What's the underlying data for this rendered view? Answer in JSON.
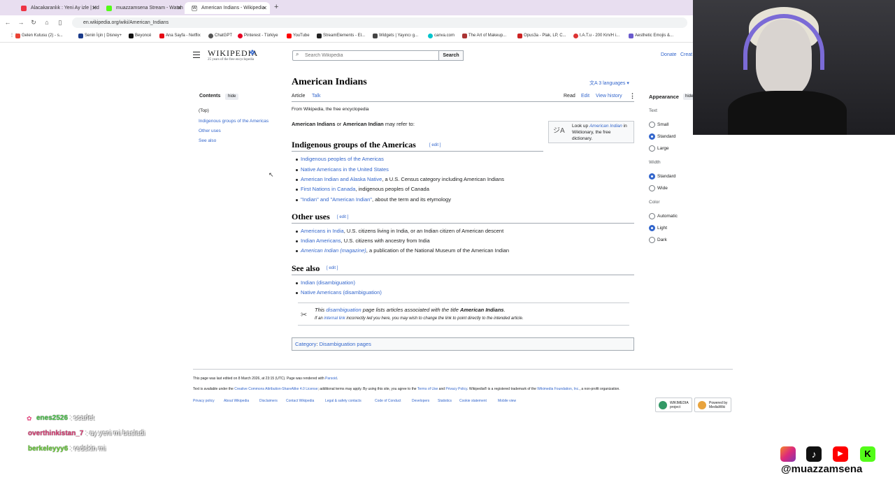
{
  "browser": {
    "tabs": [
      {
        "title": "Alacakaranlık : Yeni Ay izle | Hd"
      },
      {
        "title": "muazzamsena Stream - Watch"
      },
      {
        "title": "American Indians - Wikipedia"
      }
    ],
    "new_tab": "+",
    "url": "en.wikipedia.org/wiki/American_Indians",
    "bookmarks": [
      "Gelen Kutusu (2) - s...",
      "Senin İçin | Disney+",
      "Beyoncé",
      "Ana Sayfa - Netflix",
      "ChatGPT",
      "Pinterest - Türkiye",
      "YouTube",
      "StreamElements - El...",
      "Widgets | Yayıncı g...",
      "canva.com",
      "The Art of Makeup...",
      "Opus3a - Plak, LP, C...",
      "t.A.T.u - 200 Km/H i...",
      "Aesthetic Emojis &..."
    ]
  },
  "wiki": {
    "logo_title": "WIKIPEDIA",
    "logo_tagline": "25 years of the free encyclopedia",
    "search_placeholder": "Search Wikipedia",
    "search_button": "Search",
    "donate": "Donate",
    "create": "Creat",
    "toc": {
      "title": "Contents",
      "hide": "hide",
      "items": [
        "(Top)",
        "Indigenous groups of the Americas",
        "Other uses",
        "See also"
      ]
    },
    "page_title": "American Indians",
    "languages": "3 languages",
    "tabs": {
      "article": "Article",
      "talk": "Talk",
      "read": "Read",
      "edit": "Edit",
      "history": "View history"
    },
    "from_wp": "From Wikipedia, the free encyclopedia",
    "lead_b1": "American Indians",
    "lead_or": " or ",
    "lead_b2": "American Indian",
    "lead_rest": " may refer to:",
    "wiktionary": {
      "pre": "Look up ",
      "term": "American Indian",
      "post": " in Wiktionary, the free dictionary."
    },
    "edit_label": "edit",
    "sections": {
      "indigenous": {
        "heading": "Indigenous groups of the Americas",
        "items": [
          {
            "link": "Indigenous peoples of the Americas",
            "text": ""
          },
          {
            "link": "Native Americans in the United States",
            "text": ""
          },
          {
            "link": "American Indian and Alaska Native",
            "text": ", a U.S. Census category including American Indians"
          },
          {
            "link": "First Nations in Canada",
            "text": ", indigenous peoples of Canada"
          },
          {
            "link": "\"Indian\" and \"American Indian\"",
            "text": ", about the term and its etymology"
          }
        ]
      },
      "other": {
        "heading": "Other uses",
        "items": [
          {
            "link": "Americans in India",
            "text": ", U.S. citizens living in India, or an Indian citizen of American descent"
          },
          {
            "link": "Indian Americans",
            "text": ", U.S. citizens with ancestry from India"
          },
          {
            "link": "American Indian (magazine)",
            "text": ", a publication of the National Museum of the American Indian"
          }
        ]
      },
      "see_also": {
        "heading": "See also",
        "items": [
          {
            "link": "Indian (disambiguation)",
            "text": ""
          },
          {
            "link": "Native Americans (disambiguation)",
            "text": ""
          }
        ]
      }
    },
    "dab": {
      "pre": "This ",
      "link": "disambiguation",
      "mid": " page lists articles associated with the title ",
      "title": "American Indians",
      "post": ".",
      "line2_pre": "If an ",
      "line2_link": "internal link",
      "line2_post": " incorrectly led you here, you may wish to change the link to point directly to the intended article."
    },
    "category": {
      "label": "Category",
      "sep": ":",
      "value": "Disambiguation pages"
    },
    "appearance": {
      "title": "Appearance",
      "hide": "hide",
      "text_label": "Text",
      "text_options": [
        "Small",
        "Standard",
        "Large"
      ],
      "width_label": "Width",
      "width_options": [
        "Standard",
        "Wide"
      ],
      "color_label": "Color",
      "color_options": [
        "Automatic",
        "Light",
        "Dark"
      ]
    },
    "footer": {
      "edited": "This page was last edited on 8 March 2026, at 23:15 (UTC). Page was rendered with ",
      "parsoid": "Parsoid",
      "license_pre": "Text is available under the ",
      "license_link": "Creative Commons Attribution-ShareAlike 4.0 License",
      "license_mid": "; additional terms may apply. By using this site, you agree to the ",
      "terms": "Terms of Use",
      "and": " and ",
      "privacy": "Privacy Policy",
      "trademark_pre": ". Wikipedia® is a registered trademark of the ",
      "foundation": "Wikimedia Foundation, Inc.",
      "trademark_post": ", a non-profit organization.",
      "links": [
        "Privacy policy",
        "About Wikipedia",
        "Disclaimers",
        "Contact Wikipedia",
        "Legal & safety contacts",
        "Code of Conduct",
        "Developers",
        "Statistics",
        "Cookie statement",
        "Mobile view"
      ],
      "badge1": "WIKIMEDIA project",
      "badge2": "Powered by MediaWiki"
    }
  },
  "stream": {
    "chat": [
      {
        "user": "enes2526",
        "msg": " : scarlet",
        "color": "#4dc94d"
      },
      {
        "user": "overthinkistan_7",
        "msg": " : ay yeni mi basladi",
        "color": "#e0427a"
      },
      {
        "user": "berkeleyyy6",
        "msg": " : redskin mi",
        "color": "#6bd13b"
      }
    ],
    "handle": "@muazzamsena",
    "socials": [
      "instagram-icon",
      "tiktok-icon",
      "youtube-icon",
      "kick-icon"
    ]
  }
}
